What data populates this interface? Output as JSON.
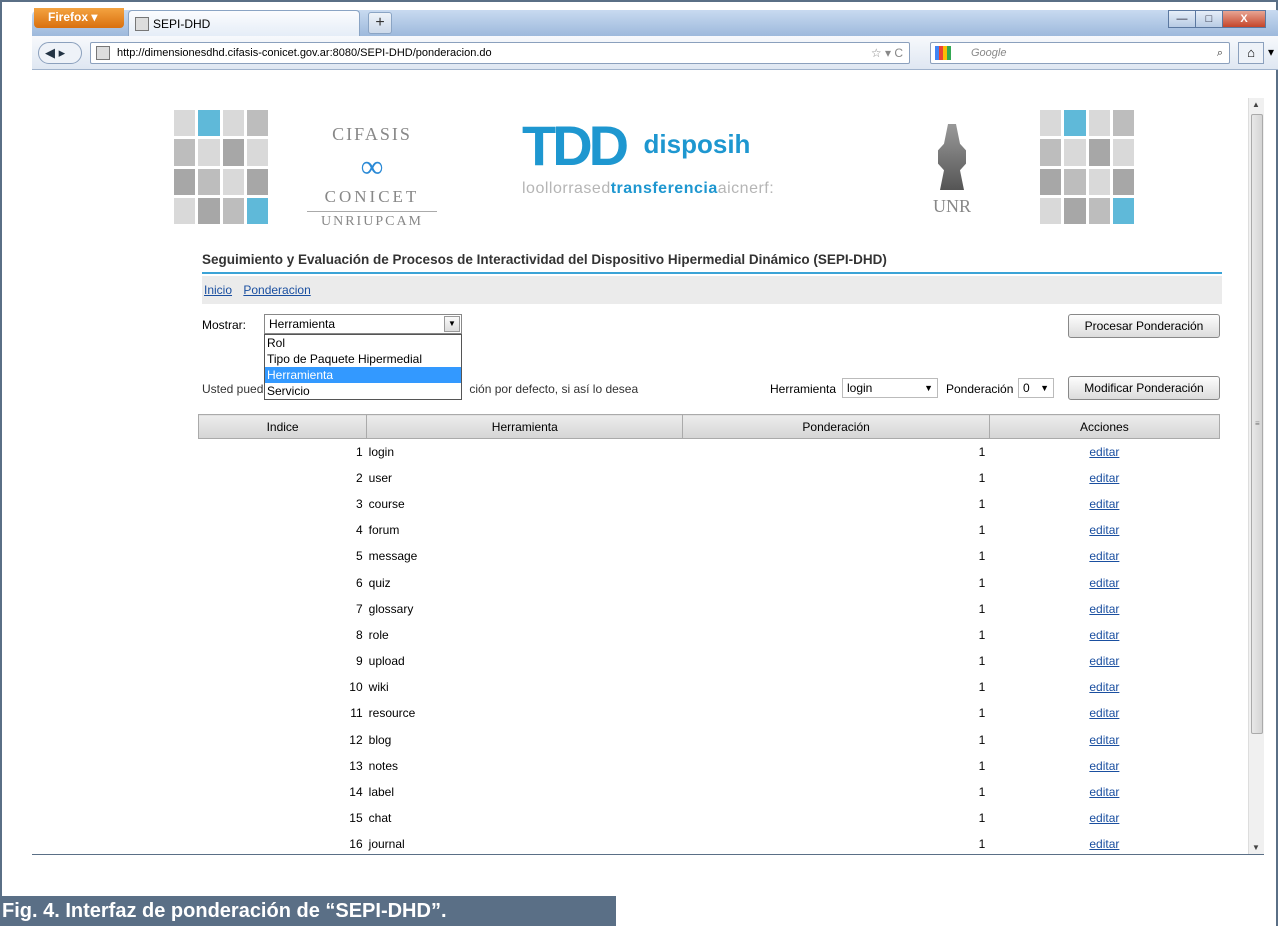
{
  "browser": {
    "menu_button": "Firefox ▾",
    "tab_title": "SEPI-DHD",
    "new_tab": "+",
    "url": "http://dimensionesdhd.cifasis-conicet.gov.ar:8080/SEPI-DHD/ponderacion.do",
    "search_placeholder": "Google",
    "window_controls": [
      "—",
      "□",
      "X"
    ]
  },
  "logos": {
    "cifasis": {
      "line1": "CIFASIS",
      "line2": "CONICET",
      "line3": "UNRIUPCAM"
    },
    "td": {
      "mark": "TDD",
      "name": "disposih",
      "tagline_pre": "loollorrased",
      "tagline_hl": "transferencia",
      "tagline_post": "aicnerf:"
    },
    "unr": {
      "name": "UNR"
    }
  },
  "app": {
    "title": "Seguimiento y Evaluación de Procesos de Interactividad del Dispositivo Hipermedial Dinámico (SEPI-DHD)",
    "breadcrumb": [
      "Inicio",
      "Ponderacion"
    ],
    "mostrar_label": "Mostrar:",
    "mostrar_value": "Herramienta",
    "mostrar_options": [
      "Rol",
      "Tipo de Paquete Hipermedial",
      "Herramienta",
      "Servicio"
    ],
    "mostrar_selected_index": 2,
    "procesar_button": "Procesar Ponderación",
    "usted_pre": "Usted pued",
    "usted_post": "ción por defecto, si así lo desea",
    "herramienta_label": "Herramienta",
    "herramienta_value": "login",
    "ponderacion_label": "Ponderación",
    "ponderacion_value": "0",
    "modificar_button": "Modificar Ponderación"
  },
  "table": {
    "headers": [
      "Indice",
      "Herramienta",
      "Ponderación",
      "Acciones"
    ],
    "action_label": "editar",
    "rows": [
      {
        "idx": "1",
        "name": "login",
        "pond": "1"
      },
      {
        "idx": "2",
        "name": "user",
        "pond": "1"
      },
      {
        "idx": "3",
        "name": "course",
        "pond": "1"
      },
      {
        "idx": "4",
        "name": "forum",
        "pond": "1"
      },
      {
        "idx": "5",
        "name": "message",
        "pond": "1"
      },
      {
        "idx": "6",
        "name": "quiz",
        "pond": "1"
      },
      {
        "idx": "7",
        "name": "glossary",
        "pond": "1"
      },
      {
        "idx": "8",
        "name": "role",
        "pond": "1"
      },
      {
        "idx": "9",
        "name": "upload",
        "pond": "1"
      },
      {
        "idx": "10",
        "name": "wiki",
        "pond": "1"
      },
      {
        "idx": "11",
        "name": "resource",
        "pond": "1"
      },
      {
        "idx": "12",
        "name": "blog",
        "pond": "1"
      },
      {
        "idx": "13",
        "name": "notes",
        "pond": "1"
      },
      {
        "idx": "14",
        "name": "label",
        "pond": "1"
      },
      {
        "idx": "15",
        "name": "chat",
        "pond": "1"
      },
      {
        "idx": "16",
        "name": "journal",
        "pond": "1"
      }
    ]
  },
  "caption": "Fig. 4. Interfaz de ponderación de “SEPI-DHD”.",
  "colors": {
    "accent": "#3ba3d6",
    "brand": "#1e97d0",
    "selection": "#3399ff",
    "caption_bg": "#5a6f86"
  }
}
